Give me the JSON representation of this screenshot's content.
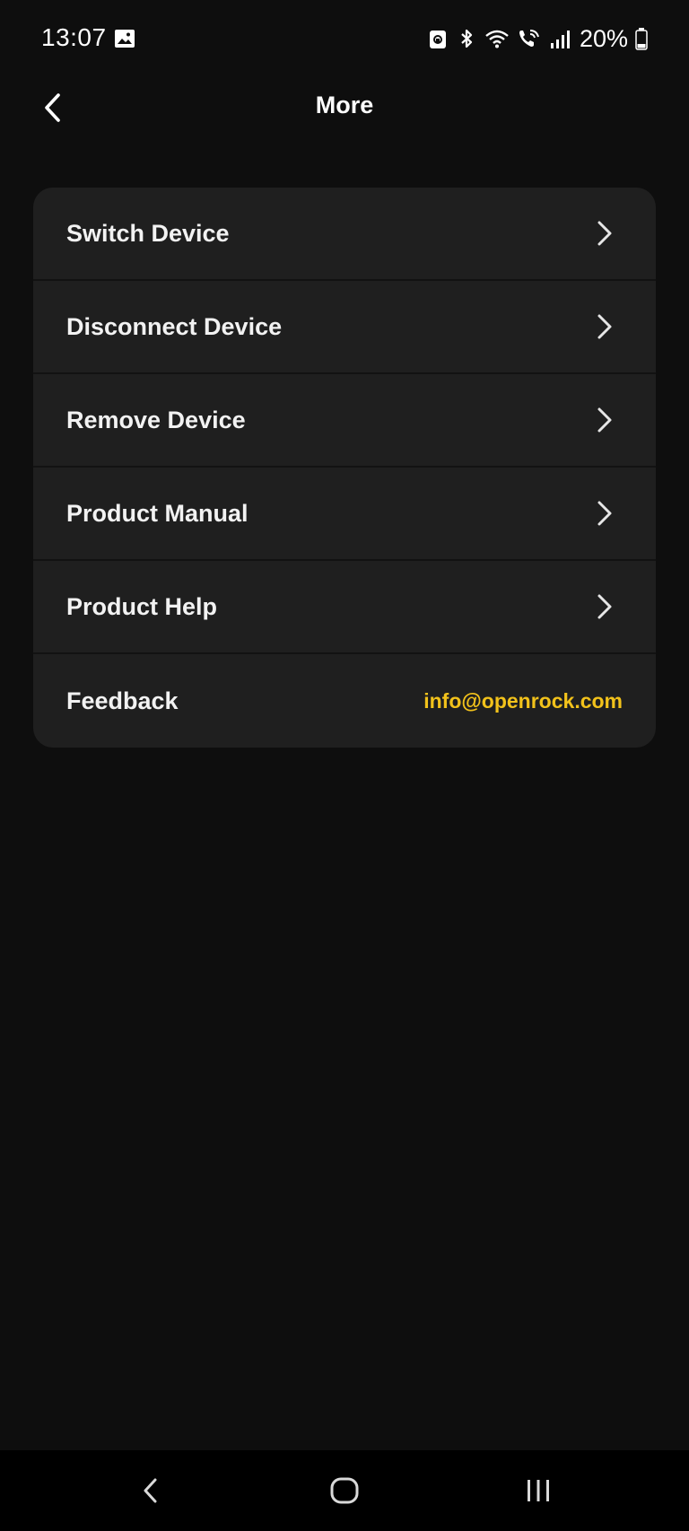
{
  "status_bar": {
    "time": "13:07",
    "battery_percent": "20%",
    "icons": [
      "gallery-icon",
      "lock-sync-icon",
      "bluetooth-icon",
      "wifi-icon",
      "wifi-calling-icon",
      "signal-icon",
      "battery-icon"
    ]
  },
  "header": {
    "title": "More",
    "back_icon": "chevron-left-icon"
  },
  "menu": {
    "items": [
      {
        "label": "Switch Device",
        "icon": "chevron-right-icon"
      },
      {
        "label": "Disconnect Device",
        "icon": "chevron-right-icon"
      },
      {
        "label": "Remove Device",
        "icon": "chevron-right-icon"
      },
      {
        "label": "Product Manual",
        "icon": "chevron-right-icon"
      },
      {
        "label": "Product Help",
        "icon": "chevron-right-icon"
      }
    ],
    "feedback": {
      "label": "Feedback",
      "email": "info@openrock.com"
    }
  },
  "nav_bar": {
    "buttons": [
      "nav-back-icon",
      "nav-home-icon",
      "nav-recents-icon"
    ]
  },
  "colors": {
    "background": "#0e0e0e",
    "card": "#1f1f1f",
    "accent": "#f2c21b",
    "text": "#ffffff"
  }
}
